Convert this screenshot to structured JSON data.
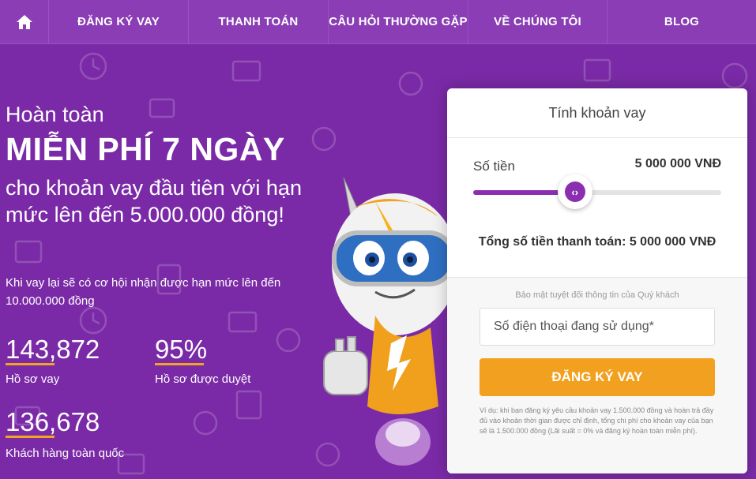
{
  "nav": {
    "items": [
      {
        "label": "ĐĂNG KÝ VAY"
      },
      {
        "label": "THANH TOÁN"
      },
      {
        "label": "CÂU HỎI THƯỜNG GẶP"
      },
      {
        "label": "VỀ CHÚNG TÔI"
      },
      {
        "label": "BLOG"
      }
    ]
  },
  "hero": {
    "lead1": "Hoàn toàn",
    "headline": "MIỄN PHÍ 7 NGÀY",
    "lead2": "cho khoản vay đầu tiên với hạn mức lên đến 5.000.000 đồng!",
    "lead3": "Khi vay lại sẽ có cơ hội nhận được hạn mức lên đến 10.000.000 đồng",
    "stats": [
      {
        "value": "143,872",
        "label": "Hồ sơ vay"
      },
      {
        "value": "95%",
        "label": "Hồ sơ được duyệt"
      },
      {
        "value": "136,678",
        "label": "Khách hàng toàn quốc"
      }
    ]
  },
  "calculator": {
    "title": "Tính khoản vay",
    "amount_label": "Số tiền",
    "amount_value": "5 000 000  VNĐ",
    "slider_fraction": 0.41,
    "total": "Tổng số tiền thanh toán: 5 000 000 VNĐ",
    "privacy_note": "Bảo mật tuyệt đối thông tin của Quý khách",
    "phone_placeholder": "Số điện thoại đang sử dụng*",
    "submit_label": "ĐĂNG KÝ VAY",
    "disclaimer": "Ví dụ: khi bạn đăng ký yêu cầu khoản vay 1.500.000 đồng và hoàn trả đầy đủ vào khoản thời gian được chỉ định, tổng chi phí cho khoản vay của bạn sẽ là 1.500.000 đồng (Lãi suất = 0% và đăng ký hoàn toàn miễn phí)."
  },
  "colors": {
    "brand_purple": "#7a2aa6",
    "accent_orange": "#f2a01f",
    "slider_purple": "#8b2fb1"
  }
}
